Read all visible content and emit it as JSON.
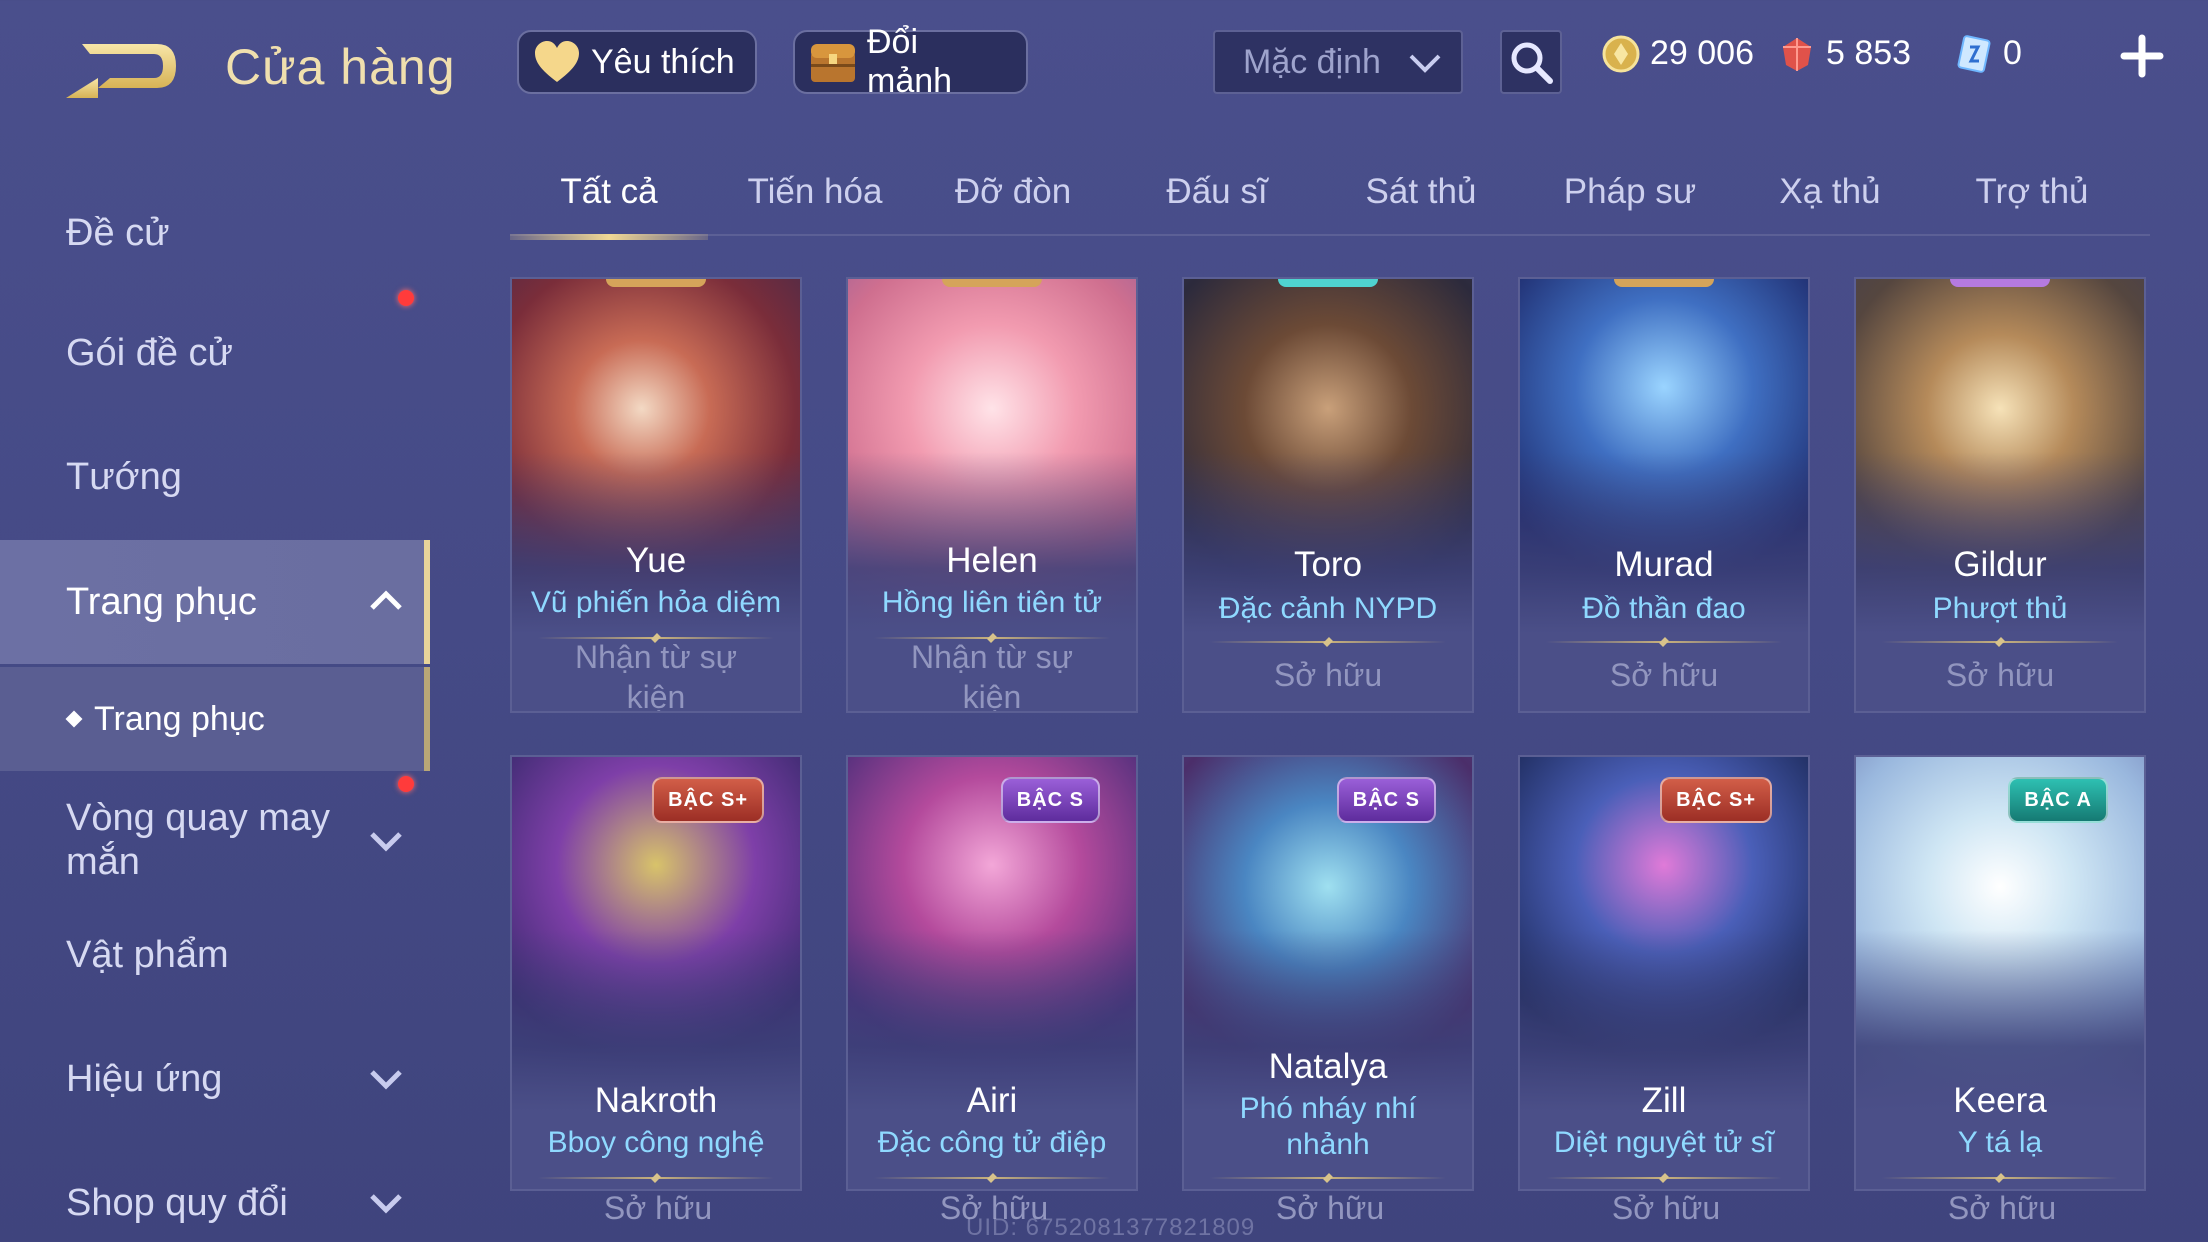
{
  "header": {
    "title": "Cửa hàng",
    "favorites_label": "Yêu thích",
    "shard_label": "Đổi mảnh",
    "sort_value": "Mặc định",
    "currencies": {
      "gold": "29 006",
      "gem": "5 853",
      "voucher": "0"
    }
  },
  "sidebar": {
    "items": [
      {
        "label": "Đề cử"
      },
      {
        "label": "Gói đề cử"
      },
      {
        "label": "Tướng"
      },
      {
        "label": "Trang phục"
      },
      {
        "label": "Vòng quay may mắn"
      },
      {
        "label": "Vật phẩm"
      },
      {
        "label": "Hiệu ứng"
      },
      {
        "label": "Shop quy đổi"
      }
    ],
    "sub_items": [
      {
        "label": "Trang phục"
      }
    ]
  },
  "tabs": [
    {
      "label": "Tất cả"
    },
    {
      "label": "Tiến hóa"
    },
    {
      "label": "Đỡ đòn"
    },
    {
      "label": "Đấu sĩ"
    },
    {
      "label": "Sát thủ"
    },
    {
      "label": "Pháp sư"
    },
    {
      "label": "Xạ thủ"
    },
    {
      "label": "Trợ thủ"
    }
  ],
  "cards": [
    {
      "hero": "Yue",
      "skin": "Vũ phiến hỏa diệm",
      "status": "Nhận từ sự kiện",
      "tier": "",
      "art": "red-fire"
    },
    {
      "hero": "Helen",
      "skin": "Hồng liên tiên tử",
      "status": "Nhận từ sự kiện",
      "tier": "",
      "art": "pink"
    },
    {
      "hero": "Toro",
      "skin": "Đặc cảnh NYPD",
      "status": "Sở hữu",
      "tier": "",
      "art": "dark"
    },
    {
      "hero": "Murad",
      "skin": "Đồ thần đao",
      "status": "Sở hữu",
      "tier": "",
      "art": "blue"
    },
    {
      "hero": "Gildur",
      "skin": "Phượt thủ",
      "status": "Sở hữu",
      "tier": "",
      "art": "bronze"
    },
    {
      "hero": "Nakroth",
      "skin": "Bboy công nghệ",
      "status": "Sở hữu",
      "tier": "BẬC S+",
      "art": "purple-green"
    },
    {
      "hero": "Airi",
      "skin": "Đặc công tử điệp",
      "status": "Sở hữu",
      "tier": "BẬC S",
      "art": "violet"
    },
    {
      "hero": "Natalya",
      "skin": "Phó nháy nhí nhảnh",
      "status": "Sở hữu",
      "tier": "BẬC S",
      "art": "teal-violet"
    },
    {
      "hero": "Zill",
      "skin": "Diệt nguyệt tử sĩ",
      "status": "Sở hữu",
      "tier": "BẬC S+",
      "art": "navy"
    },
    {
      "hero": "Keera",
      "skin": "Y tá lạ",
      "status": "Sở hữu",
      "tier": "BẬC A",
      "art": "pale"
    }
  ],
  "uid_text": "UID: 6752081377821809",
  "colors": {
    "background": "#464b88",
    "title_gold": "#f0dfae",
    "skin_name": "#8fd9ff",
    "status_gray": "#9296bf",
    "notification_red": "#ff3b3b"
  },
  "icons": [
    "back-arrow-icon",
    "heart-icon",
    "chest-icon",
    "chevron-down-icon",
    "search-icon",
    "gold-coin-icon",
    "ruby-icon",
    "voucher-icon",
    "plus-icon",
    "chevron-up-icon"
  ]
}
